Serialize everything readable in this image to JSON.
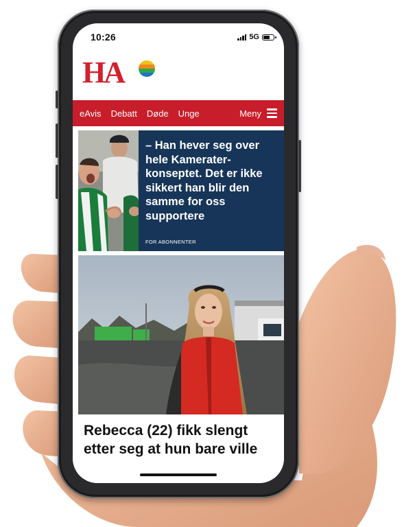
{
  "status_bar": {
    "time": "10:26",
    "network": "5G",
    "battery_level": 0.7
  },
  "brand": {
    "logo_text": "HA",
    "accent_color": "#c81d2b"
  },
  "nav": {
    "items": [
      "eAvis",
      "Debatt",
      "Døde",
      "Unge"
    ],
    "menu_label": "Meny"
  },
  "articles": [
    {
      "headline": "– Han hever seg over hele Kamerater-konseptet. Det er ikke sikkert han blir den samme for oss supportere",
      "badge": "FOR ABONNENTER",
      "background": "#173558"
    },
    {
      "headline": "Rebecca (22) fikk slengt etter seg at hun bare ville"
    }
  ],
  "icons": [
    "signal-icon",
    "battery-icon",
    "hamburger-menu-icon",
    "logo-ball-icon"
  ]
}
